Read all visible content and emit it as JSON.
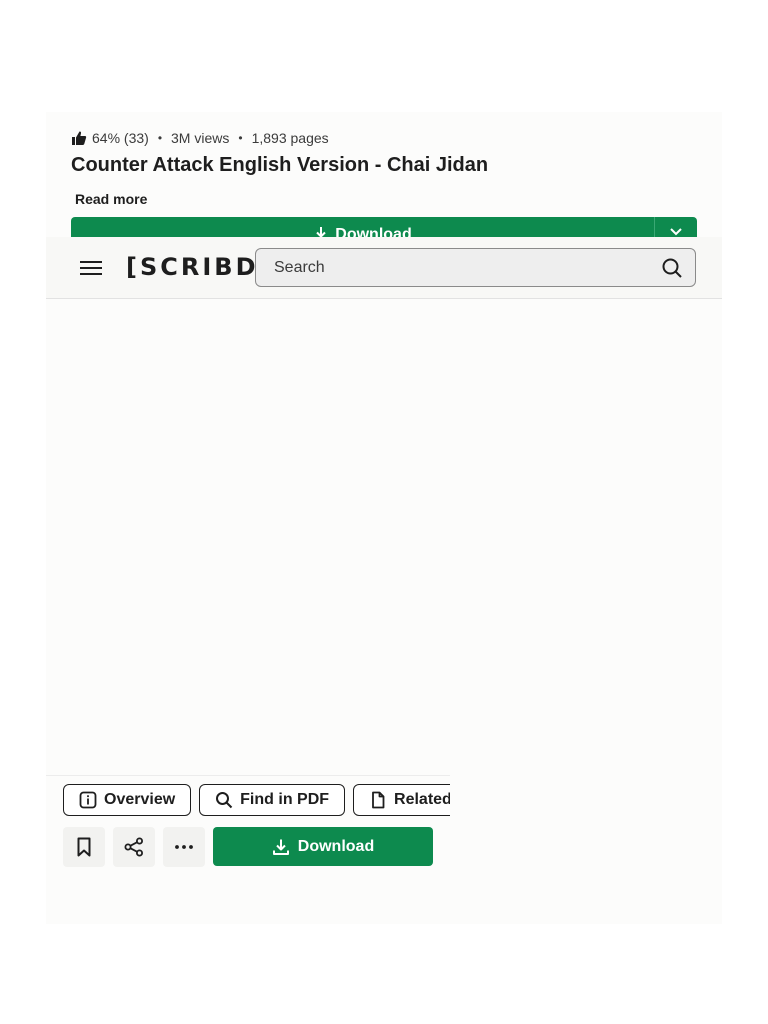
{
  "doc_meta": {
    "rating": "64% (33)",
    "views": "3M views",
    "pages": "1,893 pages",
    "separator": "•"
  },
  "doc_title": "Counter Attack English Version - Chai Jidan",
  "read_more": "Read more",
  "top_download": {
    "label": "Download"
  },
  "header": {
    "logo": "[SCRIBD]",
    "search_placeholder": "Search"
  },
  "tabs": {
    "overview": "Overview",
    "find_in_pdf": "Find in PDF",
    "related": "Related"
  },
  "actions": {
    "download_label": "Download"
  },
  "colors": {
    "accent_green": "#0d8a4e",
    "text": "#1e1e1e",
    "header_bg": "#f8f8f6"
  },
  "icons": {
    "rating": "thumbs-up-icon",
    "menu": "hamburger-menu-icon",
    "search": "search-icon",
    "overview": "info-icon",
    "find": "search-icon",
    "related": "document-icon",
    "save": "bookmark-icon",
    "share": "share-icon",
    "more": "more-dots-icon",
    "download": "download-icon",
    "dropdown": "chevron-down-icon"
  }
}
